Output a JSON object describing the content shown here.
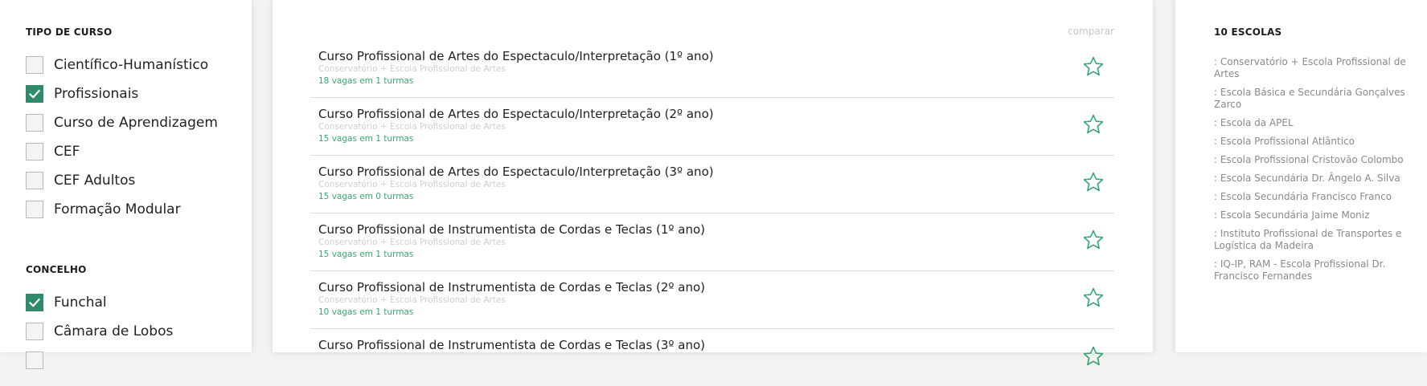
{
  "filters": {
    "tipo_title": "TIPO DE CURSO",
    "tipo_items": [
      {
        "label": "Científico-Humanístico",
        "checked": false
      },
      {
        "label": "Profissionais",
        "checked": true
      },
      {
        "label": "Curso de Aprendizagem",
        "checked": false
      },
      {
        "label": "CEF",
        "checked": false
      },
      {
        "label": "CEF Adultos",
        "checked": false
      },
      {
        "label": "Formação Modular",
        "checked": false
      }
    ],
    "concelho_title": "CONCELHO",
    "concelho_items": [
      {
        "label": "Funchal",
        "checked": true
      },
      {
        "label": "Câmara de Lobos",
        "checked": false
      }
    ]
  },
  "main": {
    "compare_label": "comparar",
    "courses": [
      {
        "title": "Curso Profissional de Artes do Espectaculo/Interpretação (1º ano)",
        "school": "Conservatório + Escola Profissional de Artes",
        "vagas": "18 vagas em 1 turmas"
      },
      {
        "title": "Curso Profissional de Artes do Espectaculo/Interpretação (2º ano)",
        "school": "Conservatório + Escola Profissional de Artes",
        "vagas": "15 vagas em 1 turmas"
      },
      {
        "title": "Curso Profissional de Artes do Espectaculo/Interpretação (3º ano)",
        "school": "Conservatório + Escola Profissional de Artes",
        "vagas": "15 vagas em 0 turmas"
      },
      {
        "title": "Curso Profissional de Instrumentista de Cordas e Teclas (1º ano)",
        "school": "Conservatório + Escola Profissional de Artes",
        "vagas": "15 vagas em 1 turmas"
      },
      {
        "title": "Curso Profissional de Instrumentista de Cordas e Teclas (2º ano)",
        "school": "Conservatório + Escola Profissional de Artes",
        "vagas": "10 vagas em 1 turmas"
      },
      {
        "title": "Curso Profissional de Instrumentista de Cordas e Teclas (3º ano)",
        "school": "",
        "vagas": ""
      }
    ]
  },
  "schools": {
    "title": "10 ESCOLAS",
    "items": [
      ": Conservatório + Escola Profissional de Artes",
      ": Escola Básica e Secundária Gonçalves Zarco",
      ": Escola da APEL",
      ": Escola Profissional Atlântico",
      ": Escola Profissional Cristovão Colombo",
      ": Escola Secundária Dr. Ângelo A. Silva",
      ": Escola Secundária Francisco Franco",
      ": Escola Secundária Jaime Moniz",
      ": Instituto Profissional de Transportes e Logística da Madeira",
      ": IQ-IP, RAM - Escola Profissional Dr. Francisco Fernandes"
    ]
  },
  "colors": {
    "accent": "#2f8a69",
    "star": "#3aa772",
    "vagas": "#3aa772"
  }
}
